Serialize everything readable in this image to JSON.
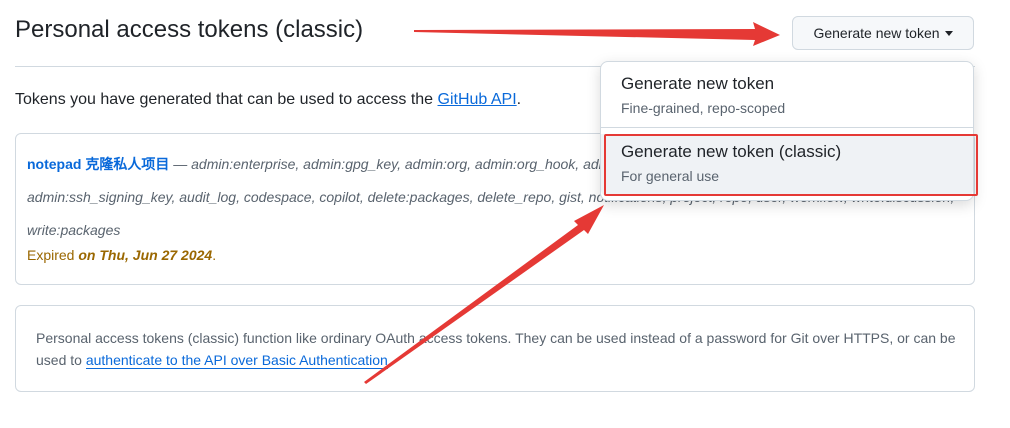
{
  "header": {
    "title": "Personal access tokens (classic)",
    "generate_button_label": "Generate new token"
  },
  "intro": {
    "text": "Tokens you have generated that can be used to access the ",
    "link_text": "GitHub API",
    "suffix": "."
  },
  "token": {
    "name": "notepad 克隆私人项目",
    "separator": " — ",
    "scopes": "admin:enterprise, admin:gpg_key, admin:org, admin:org_hook, admin:public_key, admin:repo_hook, admin:ssh_signing_key, audit_log, codespace, copilot, delete:packages, delete_repo, gist, notifications, project, repo, user, workflow, write:discussion, write:packages",
    "expired_prefix": "Expired ",
    "expired_date": "on Thu, Jun 27 2024",
    "expired_suffix": "."
  },
  "info": {
    "text": "Personal access tokens (classic) function like ordinary OAuth access tokens. They can be used instead of a password for Git over HTTPS, or can be used to ",
    "link_text": "authenticate to the API over Basic Authentication",
    "suffix": "."
  },
  "dropdown": {
    "items": [
      {
        "title": "Generate new token",
        "subtitle": "Fine-grained, repo-scoped"
      },
      {
        "title": "Generate new token (classic)",
        "subtitle": "For general use"
      }
    ]
  },
  "colors": {
    "link": "#0969da",
    "expired": "#9a6700",
    "annotation": "#e53935",
    "border": "#d1d9e0"
  },
  "icons": {
    "button_caret": "caret-down-icon"
  }
}
